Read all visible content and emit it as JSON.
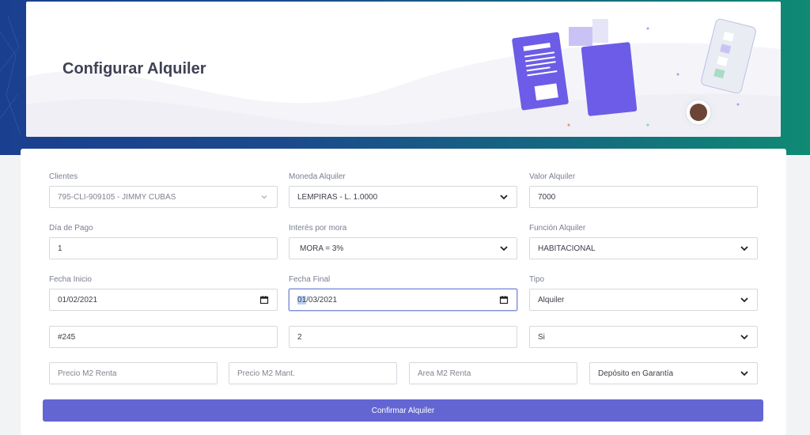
{
  "header": {
    "title": "Configurar Alquiler"
  },
  "form": {
    "row1": {
      "clientes": {
        "label": "Clientes",
        "value": "795-CLI-909105 - JIMMY CUBAS"
      },
      "moneda": {
        "label": "Moneda Alquiler",
        "value": "LEMPIRAS - L. 1.0000"
      },
      "valor": {
        "label": "Valor Alquiler",
        "value": "7000"
      }
    },
    "row2": {
      "dia_pago": {
        "label": "Día de Pago",
        "value": "1"
      },
      "interes": {
        "label": "Interés por mora",
        "value": "MORA = 3%"
      },
      "funcion": {
        "label": "Función Alquiler",
        "value": "HABITACIONAL"
      }
    },
    "row3": {
      "fecha_inicio": {
        "label": "Fecha Inicio",
        "value": "01/02/2021"
      },
      "fecha_final": {
        "label": "Fecha Final",
        "value_highlight": "01",
        "value_rest": "/03/2021"
      },
      "tipo": {
        "label": "Tipo",
        "value": "Alquiler"
      }
    },
    "row4": {
      "field_a": {
        "value": "#245"
      },
      "field_b": {
        "value": "2"
      },
      "field_c": {
        "value": "Si"
      }
    },
    "row5": {
      "precio_renta": {
        "placeholder": "Precio M2 Renta"
      },
      "precio_mant": {
        "placeholder": "Precio M2 Mant."
      },
      "area_renta": {
        "placeholder": "Area M2 Renta"
      },
      "deposito": {
        "value": "Depósito en Garantía"
      }
    },
    "submit_label": "Confirmar Alquiler"
  },
  "colors": {
    "accent": "#6366d2",
    "title": "#3f4254",
    "band_start": "#1b3f8f",
    "band_end": "#0f8a74"
  },
  "icons": [
    "chevron-down-icon",
    "calendar-icon"
  ]
}
